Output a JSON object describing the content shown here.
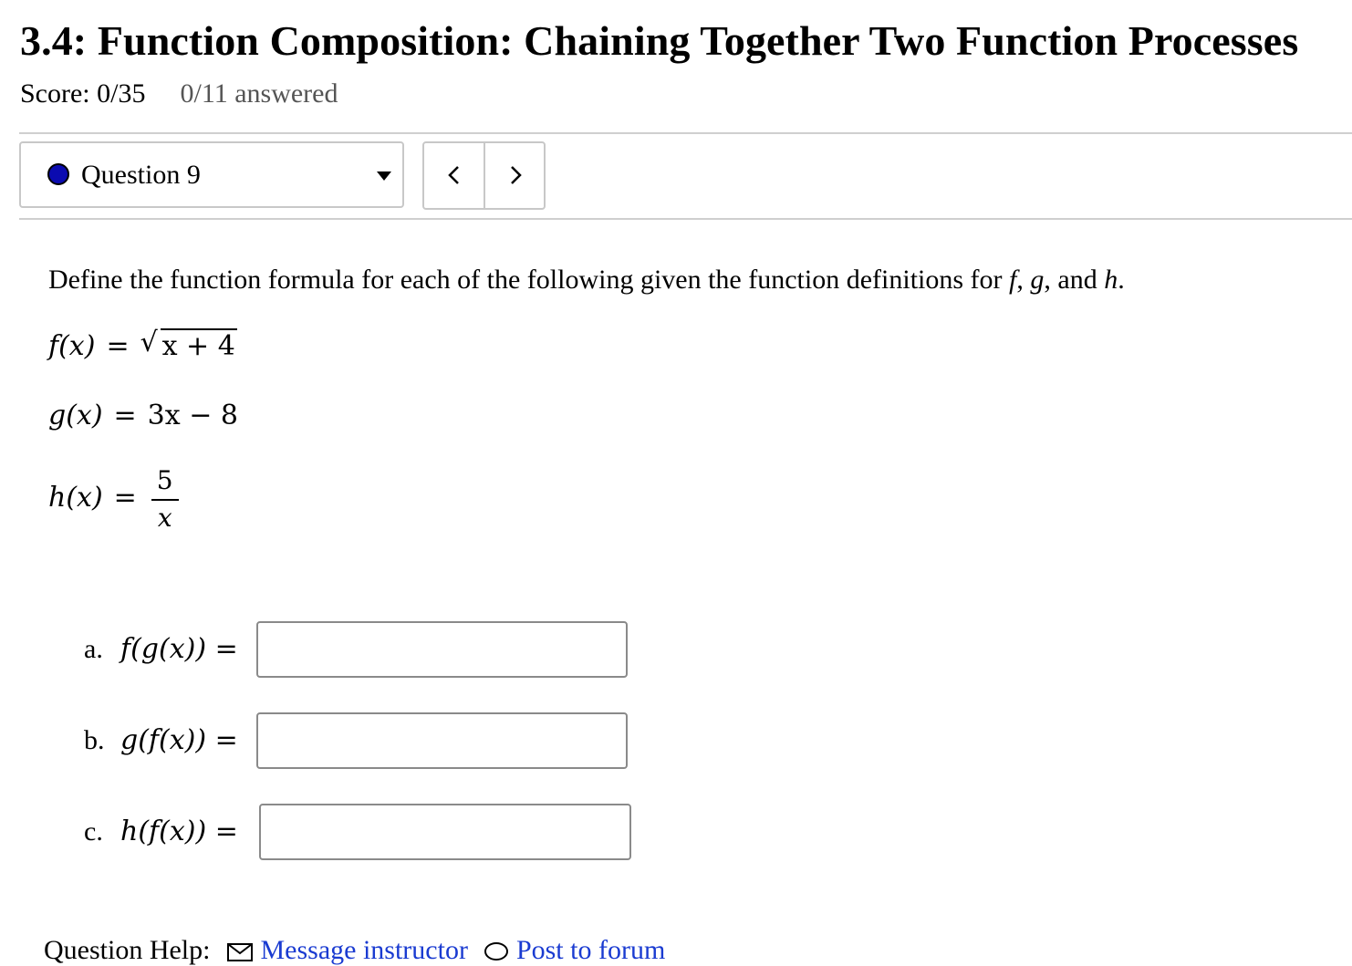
{
  "header": {
    "title": "3.4: Function Composition: Chaining Together Two Function Processes",
    "score": "Score: 0/35",
    "answered": "0/11 answered"
  },
  "question_nav": {
    "selected_question": "Question 9",
    "status_color": "#0b0bb0",
    "prev_icon": "chevron-left-icon",
    "next_icon": "chevron-right-icon"
  },
  "problem": {
    "instruction": "Define the function formula for each of the following given the function definitions for",
    "names": [
      "f",
      "g",
      "h"
    ],
    "functions": [
      {
        "lhs": "f(x)",
        "rhs": "√(x + 4)"
      },
      {
        "lhs": "g(x)",
        "rhs": "3x − 8"
      },
      {
        "lhs": "h(x)",
        "rhs_num": "5",
        "rhs_den": "x"
      }
    ]
  },
  "parts": [
    {
      "letter": "a.",
      "expr": "f(g(x))",
      "value": ""
    },
    {
      "letter": "b.",
      "expr": "g(f(x))",
      "value": ""
    },
    {
      "letter": "c.",
      "expr": "h(f(x))",
      "value": ""
    }
  ],
  "footer": {
    "label": "Question Help:",
    "message": "Message instructor",
    "post": "Post to forum"
  }
}
